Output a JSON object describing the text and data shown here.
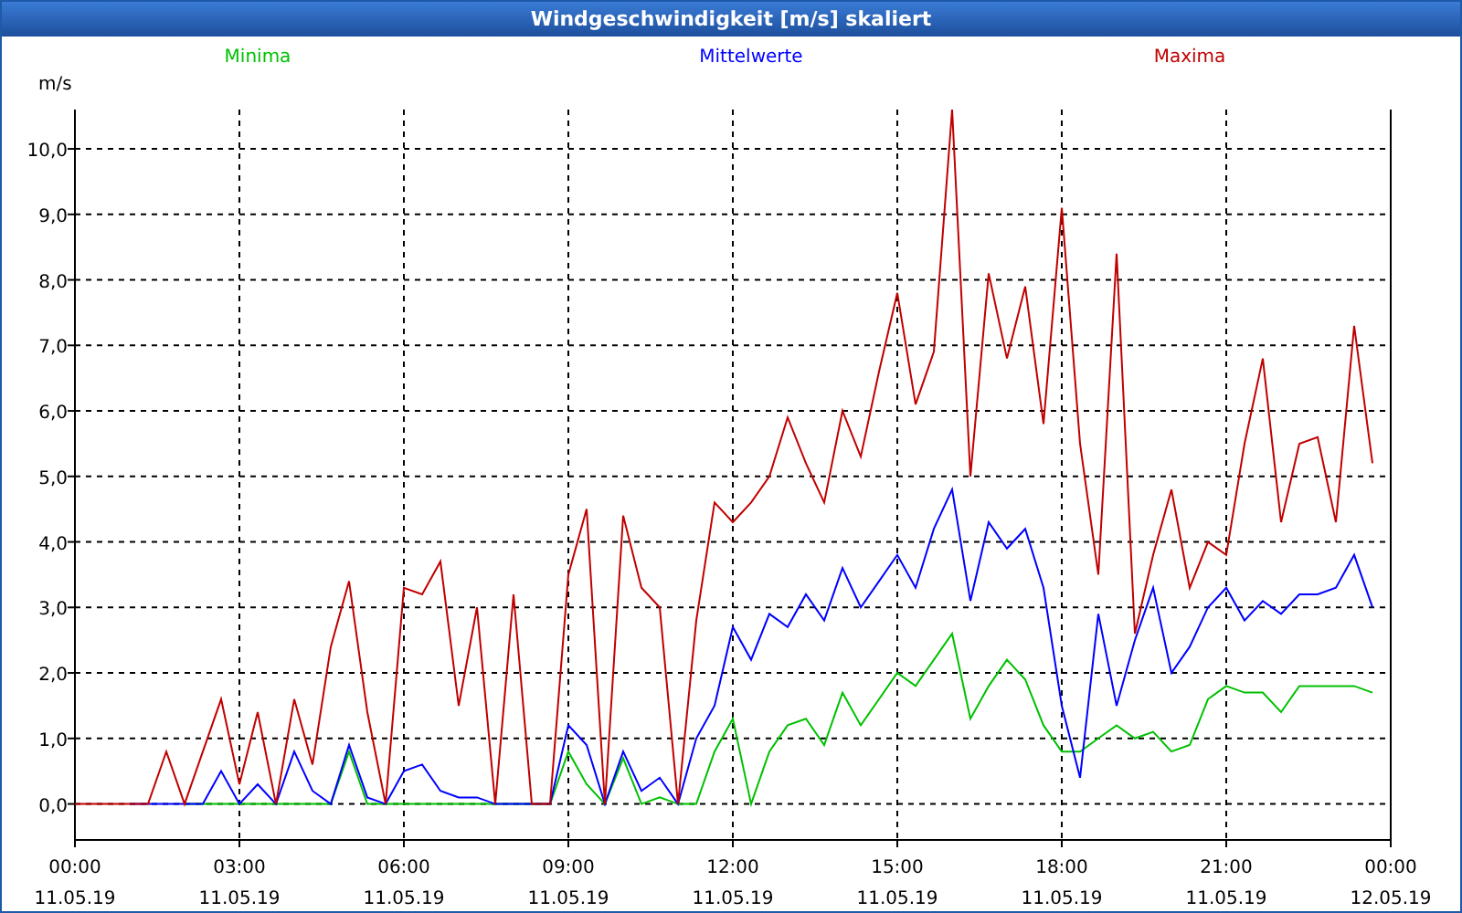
{
  "window": {
    "title": "Windgeschwindigkeit [m/s] skaliert"
  },
  "chart": {
    "chart_data": {
      "type": "line",
      "ylabel": "m/s",
      "categories": [
        "00:00 11.05.19",
        null,
        null,
        null,
        null,
        null,
        null,
        null,
        null,
        "03:00 11.05.19",
        null,
        null,
        null,
        null,
        null,
        null,
        null,
        null,
        "06:00 11.05.19",
        null,
        null,
        null,
        null,
        null,
        null,
        null,
        null,
        "09:00 11.05.19",
        null,
        null,
        null,
        null,
        null,
        null,
        null,
        null,
        "12:00 11.05.19",
        null,
        null,
        null,
        null,
        null,
        null,
        null,
        null,
        "15:00 11.05.19",
        null,
        null,
        null,
        null,
        null,
        null,
        null,
        null,
        "18:00 11.05.19",
        null,
        null,
        null,
        null,
        null,
        null,
        null,
        null,
        "21:00 11.05.19",
        null,
        null,
        null,
        null,
        null,
        null,
        null,
        null,
        "00:00 12.05.19"
      ],
      "series": [
        {
          "name": "Minima",
          "color": "#00c000",
          "values": [
            null,
            null,
            null,
            null,
            null,
            null,
            0,
            0,
            0,
            0,
            0,
            0,
            0,
            0,
            0,
            0.8,
            0,
            0,
            0,
            0,
            0,
            0,
            0,
            0,
            0,
            0,
            0,
            0.8,
            0.3,
            0,
            0.7,
            0,
            0.1,
            0,
            0,
            0.8,
            1.3,
            0,
            0.8,
            1.2,
            1.3,
            0.9,
            1.7,
            1.2,
            1.6,
            2.0,
            1.8,
            2.2,
            2.6,
            1.3,
            1.8,
            2.2,
            1.9,
            1.2,
            0.8,
            0.8,
            1.0,
            1.2,
            1.0,
            1.1,
            0.8,
            0.9,
            1.6,
            1.8,
            1.7,
            1.7,
            1.4,
            1.8,
            1.8,
            1.8,
            1.8,
            1.7,
            null
          ]
        },
        {
          "name": "Mittelwerte",
          "color": "#0000ff",
          "values": [
            null,
            null,
            null,
            0,
            0,
            0,
            0,
            0,
            0.5,
            0,
            0.3,
            0,
            0.8,
            0.2,
            0,
            0.9,
            0.1,
            0,
            0.5,
            0.6,
            0.2,
            0.1,
            0.1,
            0,
            0,
            0,
            0,
            1.2,
            0.9,
            0,
            0.8,
            0.2,
            0.4,
            0,
            1.0,
            1.5,
            2.7,
            2.2,
            2.9,
            2.7,
            3.2,
            2.8,
            3.6,
            3.0,
            3.4,
            3.8,
            3.3,
            4.2,
            4.8,
            3.1,
            4.3,
            3.9,
            4.2,
            3.3,
            1.5,
            0.4,
            2.9,
            1.5,
            2.5,
            3.3,
            2.0,
            2.4,
            3.0,
            3.3,
            2.8,
            3.1,
            2.9,
            3.2,
            3.2,
            3.3,
            3.8,
            3.0,
            null
          ]
        },
        {
          "name": "Maxima",
          "color": "#c00000",
          "values": [
            0,
            0,
            0,
            0,
            0,
            0.8,
            0,
            0.8,
            1.6,
            0.3,
            1.4,
            0,
            1.6,
            0.6,
            2.4,
            3.4,
            1.4,
            0,
            3.3,
            3.2,
            3.7,
            1.5,
            3.0,
            0,
            3.2,
            0,
            0,
            3.5,
            4.5,
            0,
            4.4,
            3.3,
            3.0,
            0,
            2.8,
            4.6,
            4.3,
            4.6,
            5.0,
            5.9,
            5.2,
            4.6,
            6.0,
            5.3,
            6.6,
            7.8,
            6.1,
            6.9,
            10.6,
            5.0,
            8.1,
            6.8,
            7.9,
            5.8,
            9.1,
            5.5,
            3.5,
            8.4,
            2.6,
            3.8,
            4.8,
            3.3,
            4.0,
            3.8,
            5.5,
            6.8,
            4.3,
            5.5,
            5.6,
            4.3,
            7.3,
            5.2,
            null
          ]
        }
      ],
      "grid": true,
      "ylim": [
        -0.55,
        10.6
      ],
      "yticks": [
        {
          "value": 0,
          "label": "0,0"
        },
        {
          "value": 1,
          "label": "1,0"
        },
        {
          "value": 2,
          "label": "2,0"
        },
        {
          "value": 3,
          "label": "3,0"
        },
        {
          "value": 4,
          "label": "4,0"
        },
        {
          "value": 5,
          "label": "5,0"
        },
        {
          "value": 6,
          "label": "6,0"
        },
        {
          "value": 7,
          "label": "7,0"
        },
        {
          "value": 8,
          "label": "8,0"
        },
        {
          "value": 9,
          "label": "9,0"
        },
        {
          "value": 10,
          "label": "10,0"
        }
      ]
    }
  }
}
